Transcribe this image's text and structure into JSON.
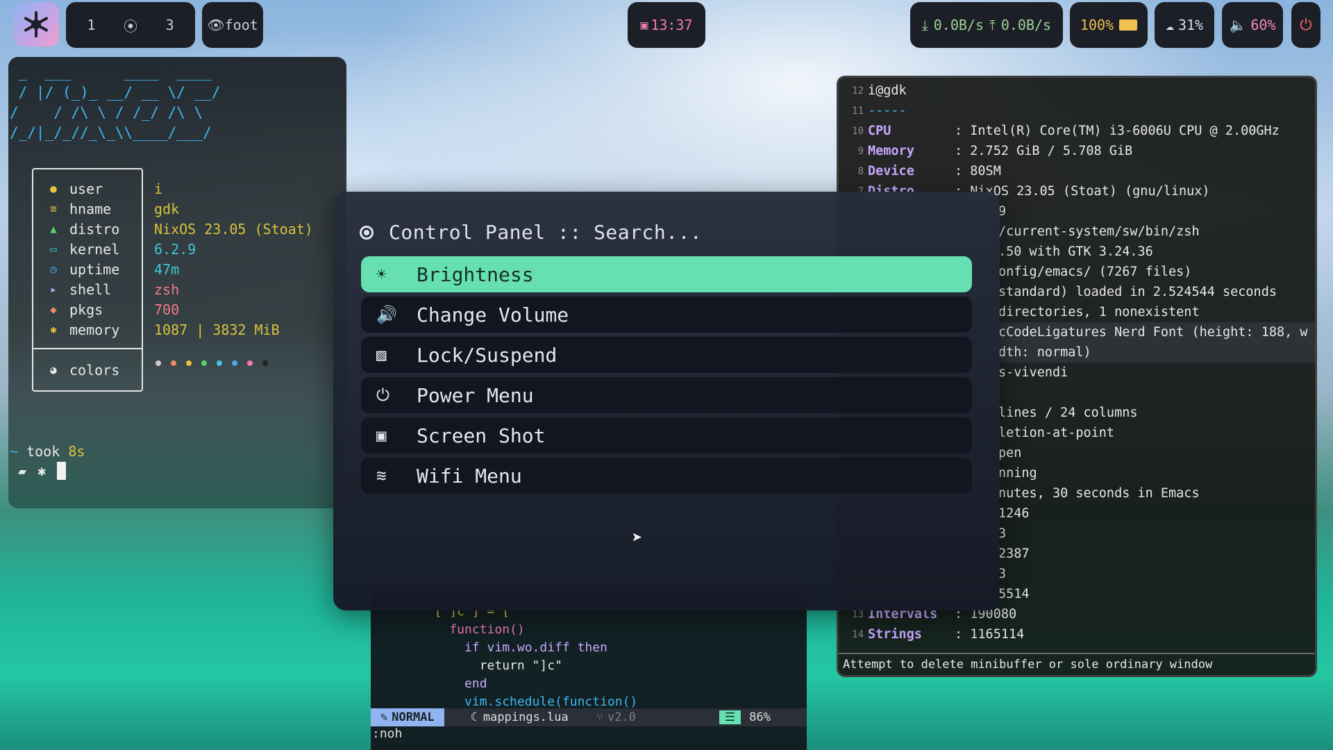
{
  "topbar": {
    "workspaces": [
      "1",
      "⦿",
      "3"
    ],
    "app": "foot",
    "clock": "13:37",
    "net_down": "0.0B/s",
    "net_up": "0.0B/s",
    "battery": "100%",
    "cpu": "31%",
    "volume": "60%"
  },
  "fetch": {
    "ascii": " _  ___      ____  ____\n / |/ (_)_ __/ __ \\/ __/\n/    / /\\ \\ / /_/ /\\ \\\n/_/|_/_//_\\_\\\\____/___/",
    "labels": [
      "user",
      "hname",
      "distro",
      "kernel",
      "uptime",
      "shell",
      "pkgs",
      "memory",
      "colors"
    ],
    "values": [
      "i",
      "gdk",
      "NixOS 23.05 (Stoat)",
      "6.2.9",
      "47m",
      "zsh",
      "700",
      "1087 | 3832 MiB"
    ],
    "palette": [
      "#cccccc",
      "#f08a6a",
      "#e8c040",
      "#5ad06a",
      "#3ec8d8",
      "#4aa8f0",
      "#f07ab8",
      "#222222"
    ],
    "prompt_tilde": "~",
    "prompt_took": "took",
    "prompt_time": "8s"
  },
  "emacs": {
    "lines": [
      {
        "ln": "12",
        "text": "i@gdk"
      },
      {
        "ln": "11",
        "text": "-----"
      },
      {
        "ln": "10",
        "key": "CPU",
        "val": ": Intel(R) Core(TM) i3-6006U CPU @ 2.00GHz"
      },
      {
        "ln": "9",
        "key": "Memory",
        "val": ": 2.752 GiB / 5.708 GiB"
      },
      {
        "ln": "8",
        "key": "Device",
        "val": ": 80SM"
      },
      {
        "ln": "7",
        "key": "Distro",
        "val": ": NixOS 23.05 (Stoat) (gnu/linux)"
      },
      {
        "ln": "",
        "val": "9"
      },
      {
        "ln": "",
        "val": "/current-system/sw/bin/zsh"
      },
      {
        "ln": "",
        "val": ".50 with GTK 3.24.36"
      },
      {
        "ln": "",
        "val": "onfig/emacs/ (7267 files)"
      },
      {
        "ln": "",
        "val": "standard) loaded in 2.524544 seconds"
      },
      {
        "ln": "",
        "val": "directories, 1 nonexistent"
      },
      {
        "ln": "",
        "val": "cCodeLigatures Nerd Font (height: 188, w"
      },
      {
        "ln": "",
        "val": "dth: normal)"
      },
      {
        "ln": "",
        "val": "s-vivendi"
      },
      {
        "ln": "",
        "val": ""
      },
      {
        "ln": "",
        "val": "lines / 24 columns"
      },
      {
        "ln": "",
        "val": "letion-at-point"
      },
      {
        "ln": "",
        "val": "pen"
      },
      {
        "ln": "",
        "val": "nning"
      },
      {
        "ln": "",
        "val": "nutes, 30 seconds in Emacs"
      },
      {
        "ln": "",
        "val": "1246"
      },
      {
        "ln": "",
        "val": "3"
      },
      {
        "ln": "",
        "val": "2387"
      },
      {
        "ln": "",
        "val": "3"
      },
      {
        "ln": "",
        "val": "5514"
      },
      {
        "ln": "13",
        "key": "Intervals",
        "val": ": 190080"
      },
      {
        "ln": "14",
        "key": "Strings",
        "val": ": 1165114"
      }
    ],
    "minibuffer": "Attempt to delete minibuffer or sole ordinary window"
  },
  "vim": {
    "lines": [
      "  [ ]c ] = [",
      "    function()",
      "      if vim.wo.diff then",
      "        return \"]c\"",
      "      end",
      "      vim.schedule(function()"
    ],
    "mode": "NORMAL",
    "file": "mappings.lua",
    "branch": "v2.0",
    "percent": "86%",
    "cmd": ":noh"
  },
  "panel": {
    "title": "Control Panel :: Search...",
    "items": [
      {
        "label": "Brightness",
        "icon": "brightness-icon",
        "glyph": "☀"
      },
      {
        "label": "Change Volume",
        "icon": "volume-icon",
        "glyph": "🔊"
      },
      {
        "label": "Lock/Suspend",
        "icon": "lock-icon",
        "glyph": "⚿"
      },
      {
        "label": "Power Menu",
        "icon": "power-icon",
        "glyph": "⏻"
      },
      {
        "label": "Screen Shot",
        "icon": "screenshot-icon",
        "glyph": "▣"
      },
      {
        "label": "Wifi Menu",
        "icon": "wifi-icon",
        "glyph": "≡"
      }
    ],
    "selected_index": 0
  },
  "colors": {
    "accent": "#66dfb2",
    "clock": "#f07ab8",
    "net": "#9ed29a",
    "battery": "#f0c050",
    "power": "#ff6a6a"
  }
}
